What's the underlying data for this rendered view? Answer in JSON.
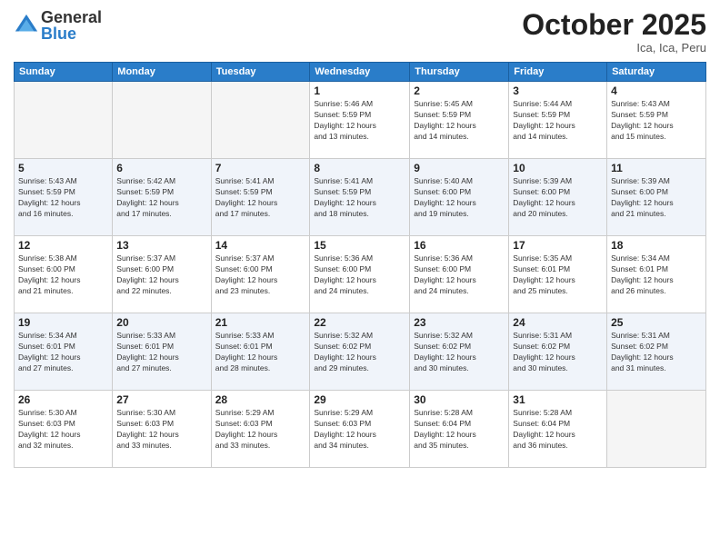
{
  "header": {
    "logo": {
      "general": "General",
      "blue": "Blue"
    },
    "title": "October 2025",
    "location": "Ica, Ica, Peru"
  },
  "days_of_week": [
    "Sunday",
    "Monday",
    "Tuesday",
    "Wednesday",
    "Thursday",
    "Friday",
    "Saturday"
  ],
  "weeks": [
    [
      {
        "day": "",
        "info": ""
      },
      {
        "day": "",
        "info": ""
      },
      {
        "day": "",
        "info": ""
      },
      {
        "day": "1",
        "info": "Sunrise: 5:46 AM\nSunset: 5:59 PM\nDaylight: 12 hours\nand 13 minutes."
      },
      {
        "day": "2",
        "info": "Sunrise: 5:45 AM\nSunset: 5:59 PM\nDaylight: 12 hours\nand 14 minutes."
      },
      {
        "day": "3",
        "info": "Sunrise: 5:44 AM\nSunset: 5:59 PM\nDaylight: 12 hours\nand 14 minutes."
      },
      {
        "day": "4",
        "info": "Sunrise: 5:43 AM\nSunset: 5:59 PM\nDaylight: 12 hours\nand 15 minutes."
      }
    ],
    [
      {
        "day": "5",
        "info": "Sunrise: 5:43 AM\nSunset: 5:59 PM\nDaylight: 12 hours\nand 16 minutes."
      },
      {
        "day": "6",
        "info": "Sunrise: 5:42 AM\nSunset: 5:59 PM\nDaylight: 12 hours\nand 17 minutes."
      },
      {
        "day": "7",
        "info": "Sunrise: 5:41 AM\nSunset: 5:59 PM\nDaylight: 12 hours\nand 17 minutes."
      },
      {
        "day": "8",
        "info": "Sunrise: 5:41 AM\nSunset: 5:59 PM\nDaylight: 12 hours\nand 18 minutes."
      },
      {
        "day": "9",
        "info": "Sunrise: 5:40 AM\nSunset: 6:00 PM\nDaylight: 12 hours\nand 19 minutes."
      },
      {
        "day": "10",
        "info": "Sunrise: 5:39 AM\nSunset: 6:00 PM\nDaylight: 12 hours\nand 20 minutes."
      },
      {
        "day": "11",
        "info": "Sunrise: 5:39 AM\nSunset: 6:00 PM\nDaylight: 12 hours\nand 21 minutes."
      }
    ],
    [
      {
        "day": "12",
        "info": "Sunrise: 5:38 AM\nSunset: 6:00 PM\nDaylight: 12 hours\nand 21 minutes."
      },
      {
        "day": "13",
        "info": "Sunrise: 5:37 AM\nSunset: 6:00 PM\nDaylight: 12 hours\nand 22 minutes."
      },
      {
        "day": "14",
        "info": "Sunrise: 5:37 AM\nSunset: 6:00 PM\nDaylight: 12 hours\nand 23 minutes."
      },
      {
        "day": "15",
        "info": "Sunrise: 5:36 AM\nSunset: 6:00 PM\nDaylight: 12 hours\nand 24 minutes."
      },
      {
        "day": "16",
        "info": "Sunrise: 5:36 AM\nSunset: 6:00 PM\nDaylight: 12 hours\nand 24 minutes."
      },
      {
        "day": "17",
        "info": "Sunrise: 5:35 AM\nSunset: 6:01 PM\nDaylight: 12 hours\nand 25 minutes."
      },
      {
        "day": "18",
        "info": "Sunrise: 5:34 AM\nSunset: 6:01 PM\nDaylight: 12 hours\nand 26 minutes."
      }
    ],
    [
      {
        "day": "19",
        "info": "Sunrise: 5:34 AM\nSunset: 6:01 PM\nDaylight: 12 hours\nand 27 minutes."
      },
      {
        "day": "20",
        "info": "Sunrise: 5:33 AM\nSunset: 6:01 PM\nDaylight: 12 hours\nand 27 minutes."
      },
      {
        "day": "21",
        "info": "Sunrise: 5:33 AM\nSunset: 6:01 PM\nDaylight: 12 hours\nand 28 minutes."
      },
      {
        "day": "22",
        "info": "Sunrise: 5:32 AM\nSunset: 6:02 PM\nDaylight: 12 hours\nand 29 minutes."
      },
      {
        "day": "23",
        "info": "Sunrise: 5:32 AM\nSunset: 6:02 PM\nDaylight: 12 hours\nand 30 minutes."
      },
      {
        "day": "24",
        "info": "Sunrise: 5:31 AM\nSunset: 6:02 PM\nDaylight: 12 hours\nand 30 minutes."
      },
      {
        "day": "25",
        "info": "Sunrise: 5:31 AM\nSunset: 6:02 PM\nDaylight: 12 hours\nand 31 minutes."
      }
    ],
    [
      {
        "day": "26",
        "info": "Sunrise: 5:30 AM\nSunset: 6:03 PM\nDaylight: 12 hours\nand 32 minutes."
      },
      {
        "day": "27",
        "info": "Sunrise: 5:30 AM\nSunset: 6:03 PM\nDaylight: 12 hours\nand 33 minutes."
      },
      {
        "day": "28",
        "info": "Sunrise: 5:29 AM\nSunset: 6:03 PM\nDaylight: 12 hours\nand 33 minutes."
      },
      {
        "day": "29",
        "info": "Sunrise: 5:29 AM\nSunset: 6:03 PM\nDaylight: 12 hours\nand 34 minutes."
      },
      {
        "day": "30",
        "info": "Sunrise: 5:28 AM\nSunset: 6:04 PM\nDaylight: 12 hours\nand 35 minutes."
      },
      {
        "day": "31",
        "info": "Sunrise: 5:28 AM\nSunset: 6:04 PM\nDaylight: 12 hours\nand 36 minutes."
      },
      {
        "day": "",
        "info": ""
      }
    ]
  ]
}
